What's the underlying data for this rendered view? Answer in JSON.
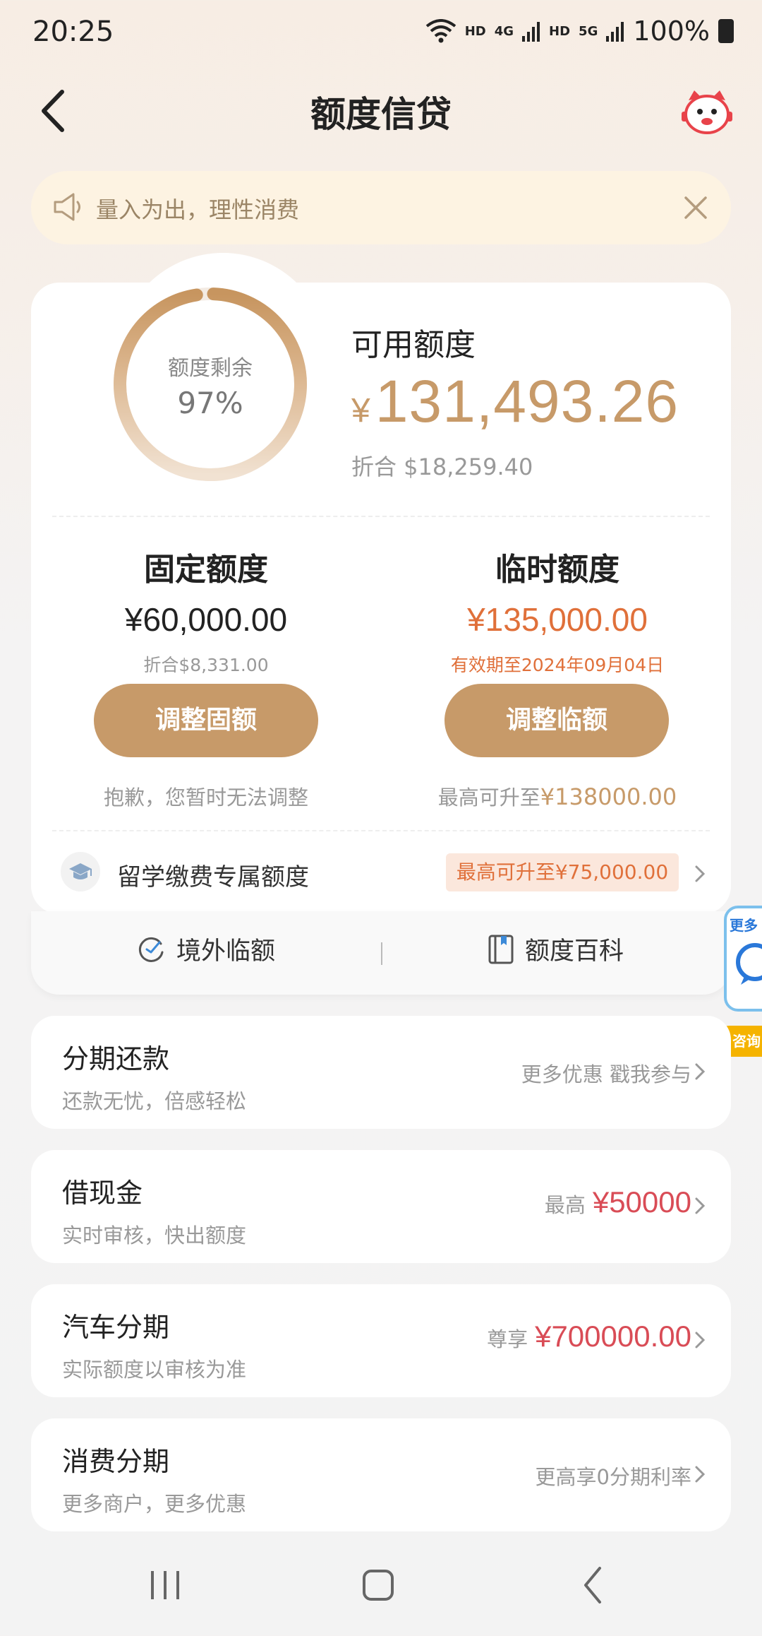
{
  "status_bar": {
    "time": "20:25",
    "hd1": "HD",
    "net1": "4G",
    "hd2": "HD",
    "net2": "5G",
    "battery": "100%"
  },
  "header": {
    "title": "额度信贷"
  },
  "notice": {
    "text": "量入为出，理性消费"
  },
  "quota": {
    "ring_label": "额度剩余",
    "ring_value": "97%",
    "ring_percent": 97,
    "available_label": "可用额度",
    "currency_symbol": "¥",
    "available_amount": "131,493.26",
    "available_usd": "折合  $18,259.40",
    "fixed": {
      "title": "固定额度",
      "amount": "¥60,000.00",
      "sub": "折合$8,331.00",
      "button": "调整固额",
      "note": "抱歉，您暂时无法调整"
    },
    "temp": {
      "title": "临时额度",
      "amount": "¥135,000.00",
      "sub": "有效期至2024年09月04日",
      "button": "调整临额",
      "note_prefix": "最高可升至",
      "note_value": "¥138000.00"
    },
    "study": {
      "label": "留学缴费专属额度",
      "badge": "最高可升至¥75,000.00"
    }
  },
  "quick_links": [
    {
      "label": "境外临额",
      "icon": "plane-clock-icon"
    },
    {
      "label": "额度百科",
      "icon": "book-icon"
    }
  ],
  "floating_widget": {
    "text": "更多",
    "badge": "咨询"
  },
  "list": [
    {
      "title": "分期还款",
      "sub": "还款无忧，倍感轻松",
      "right_prefix": "更多优惠 戳我参与",
      "right_value": ""
    },
    {
      "title": "借现金",
      "sub": "实时审核，快出额度",
      "right_prefix": "最高",
      "right_value": "¥50000"
    },
    {
      "title": "汽车分期",
      "sub": "实际额度以审核为准",
      "right_prefix": "尊享",
      "right_value": "¥700000.00"
    },
    {
      "title": "消费分期",
      "sub": "更多商户，更多优惠",
      "right_prefix": "更高享0分期利率",
      "right_value": ""
    }
  ],
  "colors": {
    "accent": "#c79a69",
    "temp_orange": "#e0703a",
    "highlight_red": "#d94c56"
  }
}
